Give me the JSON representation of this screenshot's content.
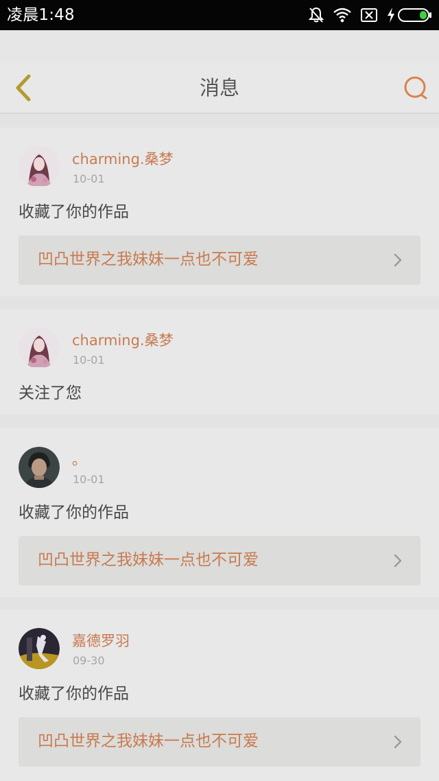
{
  "status_bar": {
    "time": "凌晨1:48",
    "icons": [
      "bell-off-icon",
      "wifi-icon",
      "no-sim-icon",
      "charging-icon",
      "battery-icon"
    ]
  },
  "header": {
    "title": "消息",
    "back_icon": "chevron-left-icon",
    "search_icon": "search-icon"
  },
  "colors": {
    "accent": "#c87a4f",
    "back_icon": "#b49a2f",
    "search_icon": "#d9834d",
    "date": "#a5a5a5",
    "text": "#474747"
  },
  "notifications": [
    {
      "username": "charming.桑梦",
      "date": "10-01",
      "action": "收藏了你的作品",
      "work_title": "凹凸世界之我妹妹一点也不可爱",
      "avatar": "anime-girl-avatar"
    },
    {
      "username": "charming.桑梦",
      "date": "10-01",
      "action": "关注了您",
      "avatar": "anime-girl-avatar"
    },
    {
      "username": "。",
      "date": "10-01",
      "action": "收藏了你的作品",
      "work_title": "凹凸世界之我妹妹一点也不可爱",
      "avatar": "man-portrait-avatar"
    },
    {
      "username": "嘉德罗羽",
      "date": "09-30",
      "action": "收藏了你的作品",
      "work_title": "凹凸世界之我妹妹一点也不可爱",
      "avatar": "dark-figure-avatar"
    }
  ]
}
